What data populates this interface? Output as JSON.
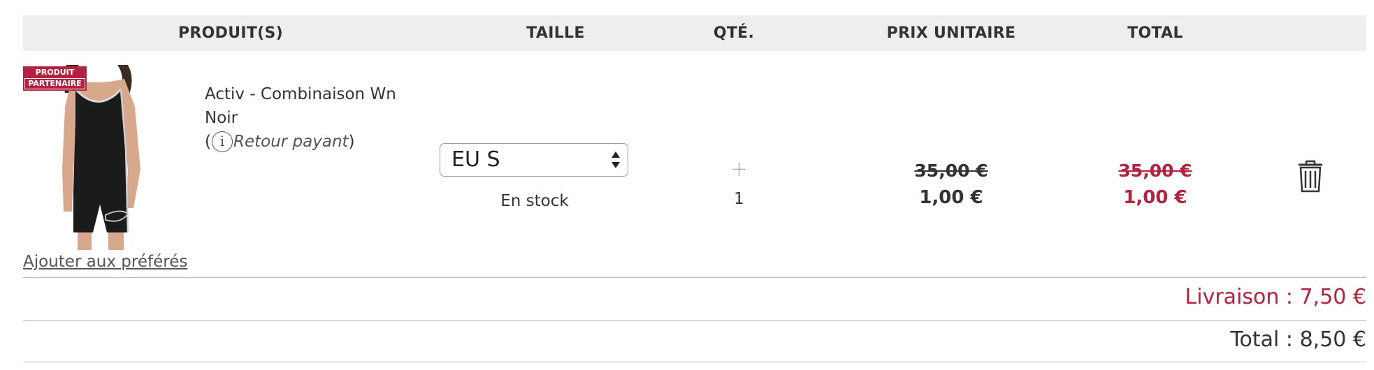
{
  "table_header": {
    "product": "PRODUIT(S)",
    "size": "TAILLE",
    "qty": "QTÉ.",
    "unit_price": "PRIX UNITAIRE",
    "total": "TOTAL"
  },
  "item": {
    "badge_line1": "PRODUIT",
    "badge_line2": "PARTENAIRE",
    "name_line1": "Activ - Combinaison Wn",
    "name_line2": "Noir",
    "return_open": "(",
    "return_label": "Retour payant",
    "return_close": ")",
    "add_favorite": "Ajouter aux préférés",
    "size_selected": "EU S",
    "stock_status": "En stock",
    "qty_plus": "+",
    "quantity": "1",
    "unit_price_old": "35,00 €",
    "unit_price_new": "1,00 €",
    "total_old": "35,00 €",
    "total_new": "1,00 €"
  },
  "summary": {
    "shipping": "Livraison : 7,50 €",
    "total": "Total : 8,50 €"
  },
  "colors": {
    "accent": "#b5223f",
    "header_bg": "#efeeee",
    "text": "#333333"
  },
  "icons": {
    "info": "info-icon",
    "trash": "trash-icon",
    "select_arrows": "select-arrows-icon"
  }
}
